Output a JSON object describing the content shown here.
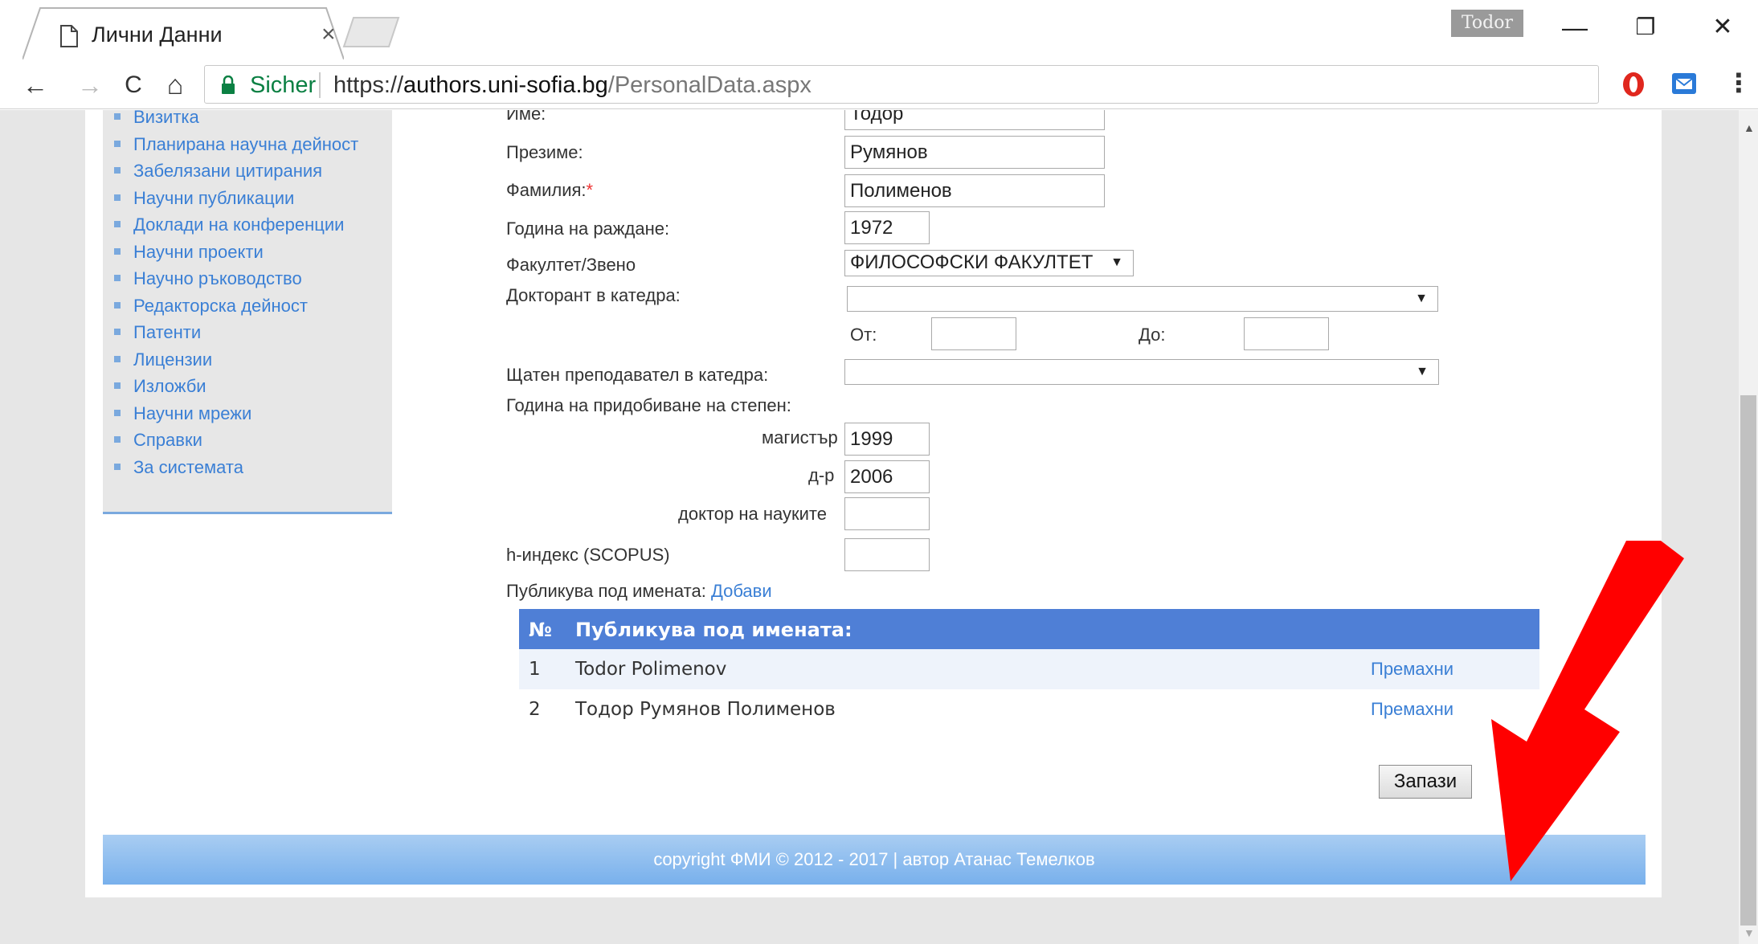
{
  "browser": {
    "tab_title": "Лични Данни",
    "tab_close": "×",
    "profile_name": "Todor",
    "window_controls": {
      "minimize": "—",
      "restore": "❐",
      "close": "✕"
    },
    "nav": {
      "back": "←",
      "forward": "→",
      "reload": "C",
      "home": "⌂"
    },
    "secure_label": "Sicher",
    "url_scheme": "https://",
    "url_host": "authors.uni-sofia.bg",
    "url_path": "/PersonalData.aspx",
    "icons": [
      "doc-icon",
      "lock-icon",
      "star-icon",
      "opera-icon",
      "mail-icon",
      "kebab-menu-icon"
    ]
  },
  "sidebar": {
    "items": [
      "Визитка",
      "Планирана научна дейност",
      "Забелязани цитирания",
      "Научни публикации",
      "Доклади на конференции",
      "Научни проекти",
      "Научно ръководство",
      "Редакторска дейност",
      "Патенти",
      "Лицензии",
      "Изложби",
      "Научни мрежи",
      "Справки",
      "За системата"
    ]
  },
  "form": {
    "first_name_label": "Име:",
    "first_name_value": "Тодор",
    "middle_name_label": "Презиме:",
    "middle_name_value": "Румянов",
    "last_name_label": "Фамилия:",
    "required_mark": "*",
    "last_name_value": "Полименов",
    "birth_year_label": "Година на раждане:",
    "birth_year_value": "1972",
    "faculty_label": "Факултет/Звено",
    "faculty_value": "ФИЛОСОФСКИ ФАКУЛТЕТ",
    "phd_dept_label": "Докторант в катедра:",
    "phd_dept_value": "",
    "from_label": "От:",
    "from_value": "",
    "to_label": "До:",
    "to_value": "",
    "staff_dept_label": "Щатен преподавател в катедра:",
    "staff_dept_value": "",
    "degree_year_label": "Година на придобиване на степен:",
    "master_label": "магистър",
    "master_value": "1999",
    "phd_label": "д-р",
    "phd_value": "2006",
    "dsc_label": "доктор на науките",
    "dsc_value": "",
    "hindex_label": "h-индекс (SCOPUS)",
    "hindex_value": "",
    "publishes_as_label": "Публикува под имената:",
    "add_link": "Добави"
  },
  "names_table": {
    "col_num": "№",
    "col_name": "Публикува под имената:",
    "rows": [
      {
        "num": "1",
        "name": "Todor Polimenov",
        "action": "Премахни"
      },
      {
        "num": "2",
        "name": "Тодор Румянов Полименов",
        "action": "Премахни"
      }
    ]
  },
  "save_label": "Запази",
  "footer_text": "copyright ФМИ © 2012 - 2017 | автор Атанас Темелков",
  "colors": {
    "link": "#3a7fd5",
    "table_header": "#4f7fd6",
    "footer": "#78b0ec",
    "annotation_arrow": "#ff0000",
    "secure": "#0b8043"
  }
}
